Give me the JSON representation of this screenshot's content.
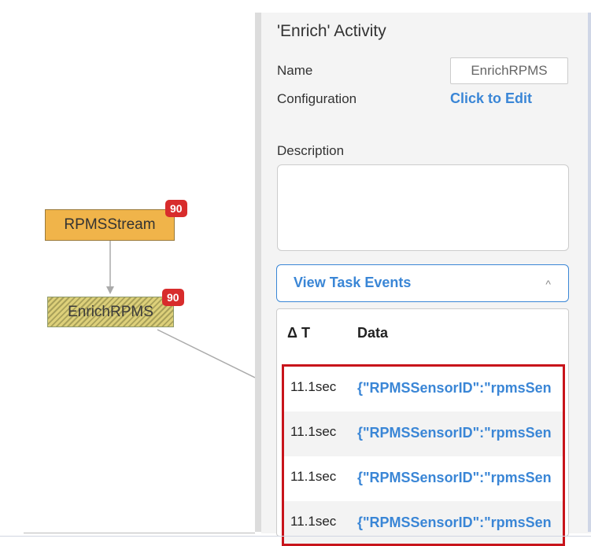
{
  "canvas": {
    "nodes": [
      {
        "label": "RPMSStream",
        "badge": "90"
      },
      {
        "label": "EnrichRPMS",
        "badge": "90"
      }
    ]
  },
  "panel": {
    "title": "'Enrich' Activity",
    "name_label": "Name",
    "name_value": "EnrichRPMS",
    "config_label": "Configuration",
    "config_link": "Click to Edit",
    "description_label": "Description",
    "view_events_label": "View Task Events",
    "view_events_chevron": "^",
    "events": {
      "headers": {
        "dt": "Δ T",
        "data": "Data"
      },
      "rows": [
        {
          "dt": "11.1sec",
          "data": "{\"RPMSSensorID\":\"rpmsSen"
        },
        {
          "dt": "11.1sec",
          "data": "{\"RPMSSensorID\":\"rpmsSen"
        },
        {
          "dt": "11.1sec",
          "data": "{\"RPMSSensorID\":\"rpmsSen"
        },
        {
          "dt": "11.1sec",
          "data": "{\"RPMSSensorID\":\"rpmsSen"
        }
      ]
    }
  },
  "colors": {
    "link": "#3a86d6",
    "badge": "#d82c2c",
    "highlight_border": "#c8141b",
    "stream_node": "#f0b44a"
  }
}
